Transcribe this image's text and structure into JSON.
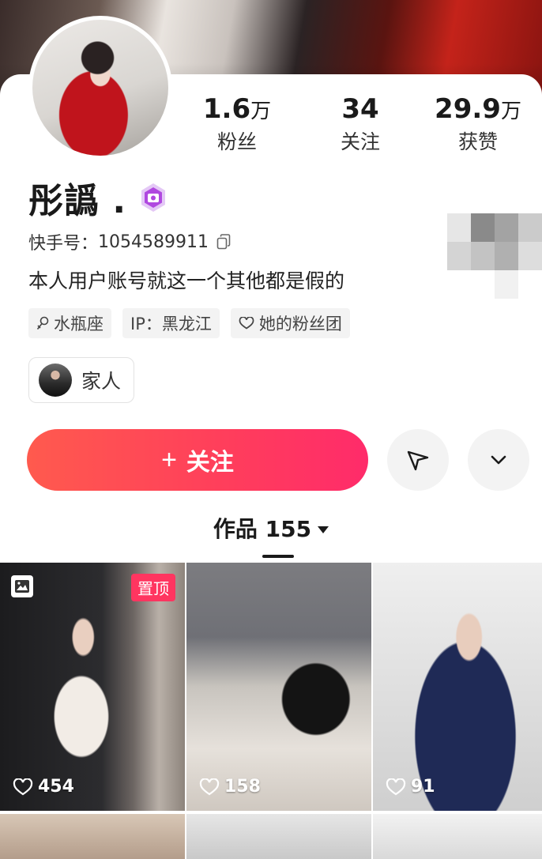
{
  "profile": {
    "name": "彤譌 .",
    "id_label": "快手号：",
    "id_value": "1054589911",
    "bio": "本人用户账号就这一个其他都是假的"
  },
  "stats": [
    {
      "num": "1.6",
      "unit": "万",
      "label": "粉丝"
    },
    {
      "num": "34",
      "unit": "",
      "label": "关注"
    },
    {
      "num": "29.9",
      "unit": "万",
      "label": "获赞"
    }
  ],
  "tags": [
    "水瓶座",
    "IP：黑龙江",
    "她的粉丝团"
  ],
  "family": {
    "label": "家人"
  },
  "actions": {
    "follow_label": "关注"
  },
  "tabs": {
    "works_label": "作品 155"
  },
  "grid": [
    {
      "likes": "454",
      "pinned_label": "置顶"
    },
    {
      "likes": "158"
    },
    {
      "likes": "91"
    }
  ],
  "colors": {
    "accent": "#ff3d5c",
    "pin": "#ff3560",
    "badge": "#b048e0"
  }
}
